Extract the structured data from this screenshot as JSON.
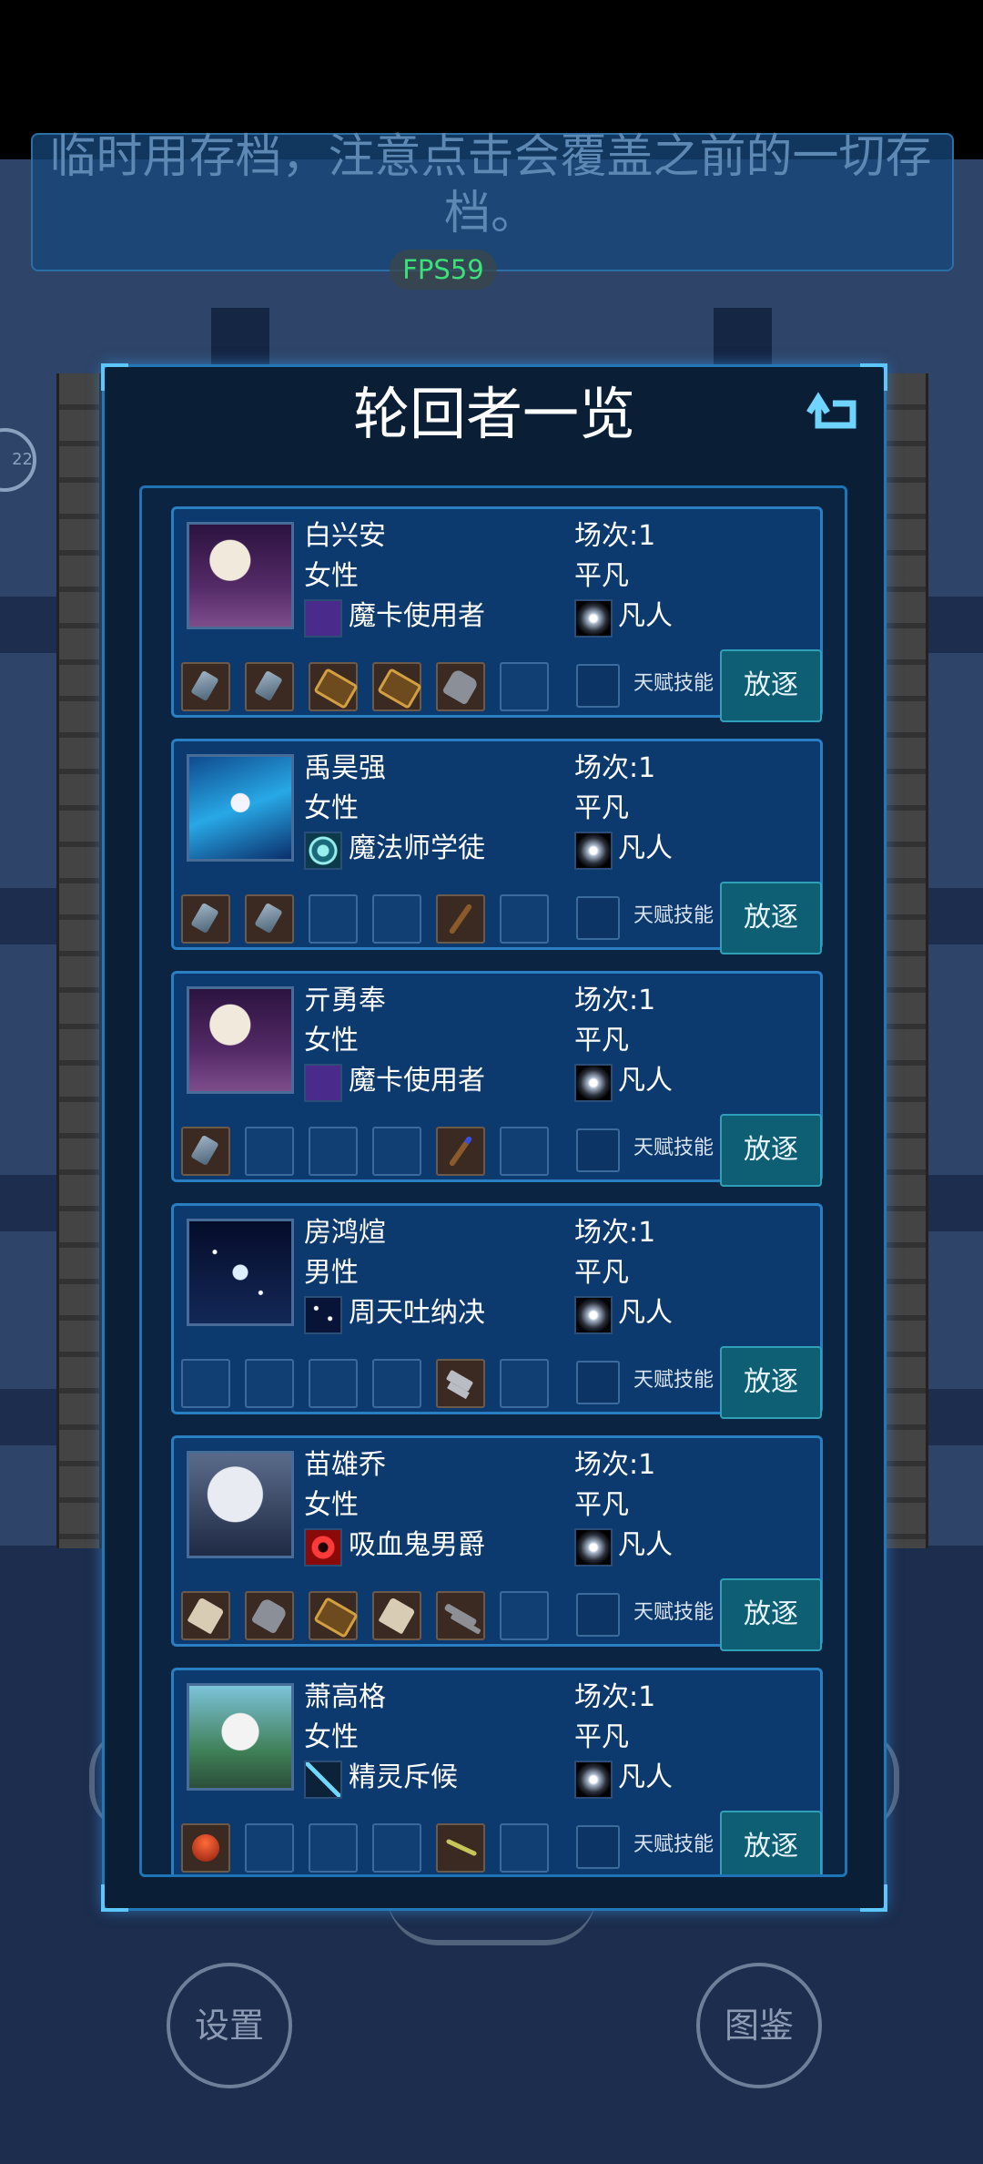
{
  "notice": {
    "text": "临时用存档，注意点击会覆盖之前的一切存档。"
  },
  "fps": "FPS59",
  "side_badge": "22",
  "panel": {
    "title": "轮回者一览"
  },
  "bottom": {
    "settings_label": "设置",
    "atlas_label": "图鉴"
  },
  "talent_label": "天赋技能",
  "exile_label": "放逐",
  "characters": [
    {
      "name": "白兴安",
      "gender": "女性",
      "class": "魔卡使用者",
      "round": "场次:1",
      "rank": "平凡",
      "realm": "凡人"
    },
    {
      "name": "禹昊强",
      "gender": "女性",
      "class": "魔法师学徒",
      "round": "场次:1",
      "rank": "平凡",
      "realm": "凡人"
    },
    {
      "name": "亓勇奉",
      "gender": "女性",
      "class": "魔卡使用者",
      "round": "场次:1",
      "rank": "平凡",
      "realm": "凡人"
    },
    {
      "name": "房鸿煊",
      "gender": "男性",
      "class": "周天吐纳决",
      "round": "场次:1",
      "rank": "平凡",
      "realm": "凡人"
    },
    {
      "name": "苗雄乔",
      "gender": "女性",
      "class": "吸血鬼男爵",
      "round": "场次:1",
      "rank": "平凡",
      "realm": "凡人"
    },
    {
      "name": "萧高格",
      "gender": "女性",
      "class": "精灵斥候",
      "round": "场次:1",
      "rank": "平凡",
      "realm": "凡人"
    }
  ],
  "colors": {
    "accent": "#2378b8",
    "card": "#0d3a6e",
    "fps": "#3ee07a",
    "exile_button": "#0e5f74"
  },
  "icons": {
    "back": "return-arrow-icon",
    "class": "class-icon",
    "realm": "star-burst-icon"
  }
}
